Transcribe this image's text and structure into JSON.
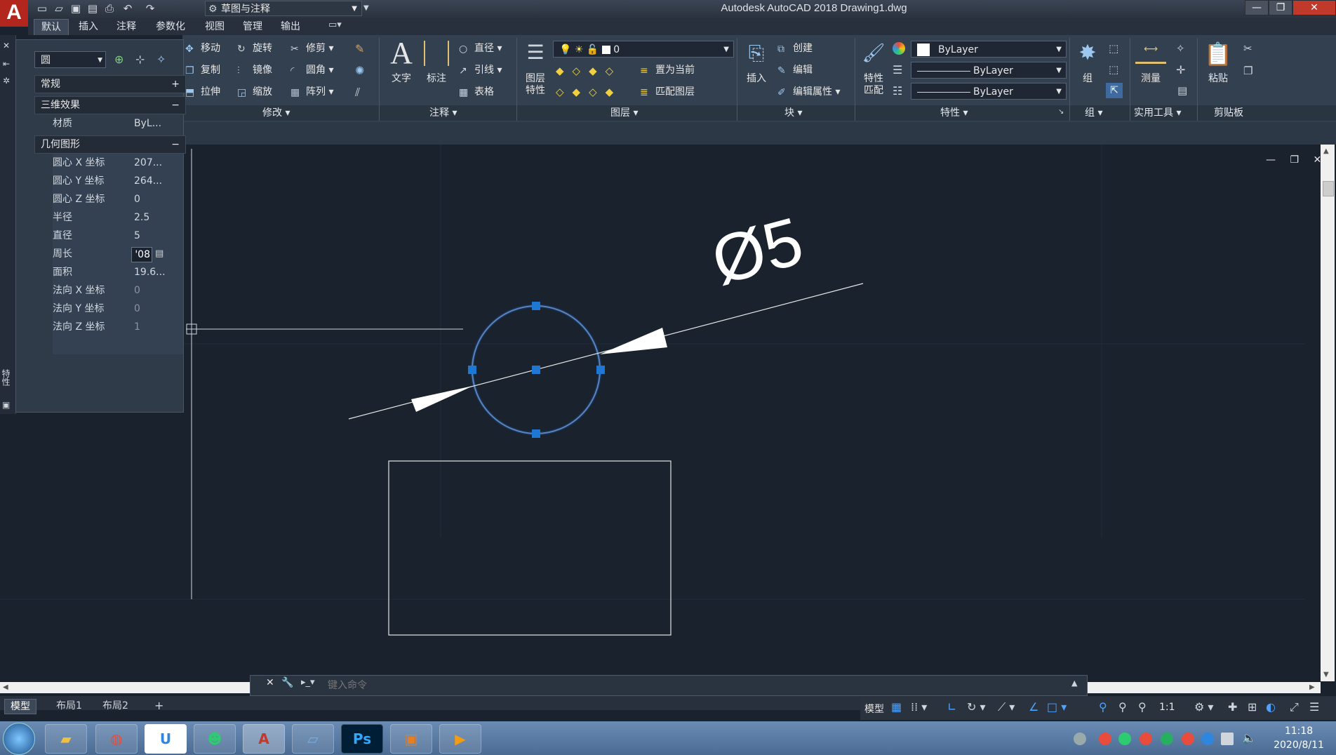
{
  "app": {
    "logo": "A",
    "window_title": "Autodesk AutoCAD 2018    Drawing1.dwg",
    "workspace": "草图与注释"
  },
  "colors": {
    "accent": "#1f77d4",
    "grip": "#1f77d4",
    "background": "#1a222e"
  },
  "tabs": [
    "默认",
    "插入",
    "注释",
    "参数化",
    "视图",
    "管理",
    "输出"
  ],
  "ribbon": {
    "modify": {
      "title": "修改",
      "items": [
        "移动",
        "旋转",
        "修剪",
        "复制",
        "镜像",
        "圆角",
        "拉伸",
        "缩放",
        "阵列"
      ]
    },
    "annotation": {
      "title": "注释",
      "text": "文字",
      "dimension": "标注",
      "items": [
        "直径",
        "引线",
        "表格"
      ]
    },
    "layers": {
      "title": "图层",
      "props": "图层\n特性",
      "current_layer": "0",
      "items": [
        "置为当前",
        "匹配图层"
      ]
    },
    "block": {
      "title": "块",
      "insert": "插入",
      "items": [
        "创建",
        "编辑",
        "编辑属性"
      ]
    },
    "properties": {
      "title": "特性",
      "match": "特性\n匹配",
      "color": "ByLayer",
      "linetype": "ByLayer",
      "lineweight": "ByLayer"
    },
    "groups": {
      "title": "组",
      "group": "组"
    },
    "utilities": {
      "title": "实用工具",
      "measure": "测量"
    },
    "clipboard": {
      "title": "剪贴板",
      "paste": "粘贴"
    }
  },
  "properties_palette": {
    "object_type": "圆",
    "sections": {
      "general": "常规",
      "effects_3d": "三维效果",
      "geometry": "几何图形"
    },
    "material": {
      "label": "材质",
      "value": "ByL..."
    },
    "rows": [
      {
        "label": "圆心 X 坐标",
        "value": "207..."
      },
      {
        "label": "圆心 Y 坐标",
        "value": "264..."
      },
      {
        "label": "圆心 Z 坐标",
        "value": "0"
      },
      {
        "label": "半径",
        "value": "2.5"
      },
      {
        "label": "直径",
        "value": "5"
      },
      {
        "label": "周长",
        "value": "'08"
      },
      {
        "label": "面积",
        "value": "19.6..."
      },
      {
        "label": "法向 X 坐标",
        "value": "0"
      },
      {
        "label": "法向 Y 坐标",
        "value": "0"
      },
      {
        "label": "法向 Z 坐标",
        "value": "1"
      }
    ],
    "strip_label": "特性"
  },
  "drawing": {
    "dimension_text": "Ø5"
  },
  "command_line": {
    "placeholder": "键入命令"
  },
  "layout_tabs": [
    "模型",
    "布局1",
    "布局2"
  ],
  "status": {
    "model": "模型",
    "scale": "1:1"
  },
  "taskbar": {
    "ps_label": "Ps",
    "time": "11:18",
    "date": "2020/8/11"
  }
}
